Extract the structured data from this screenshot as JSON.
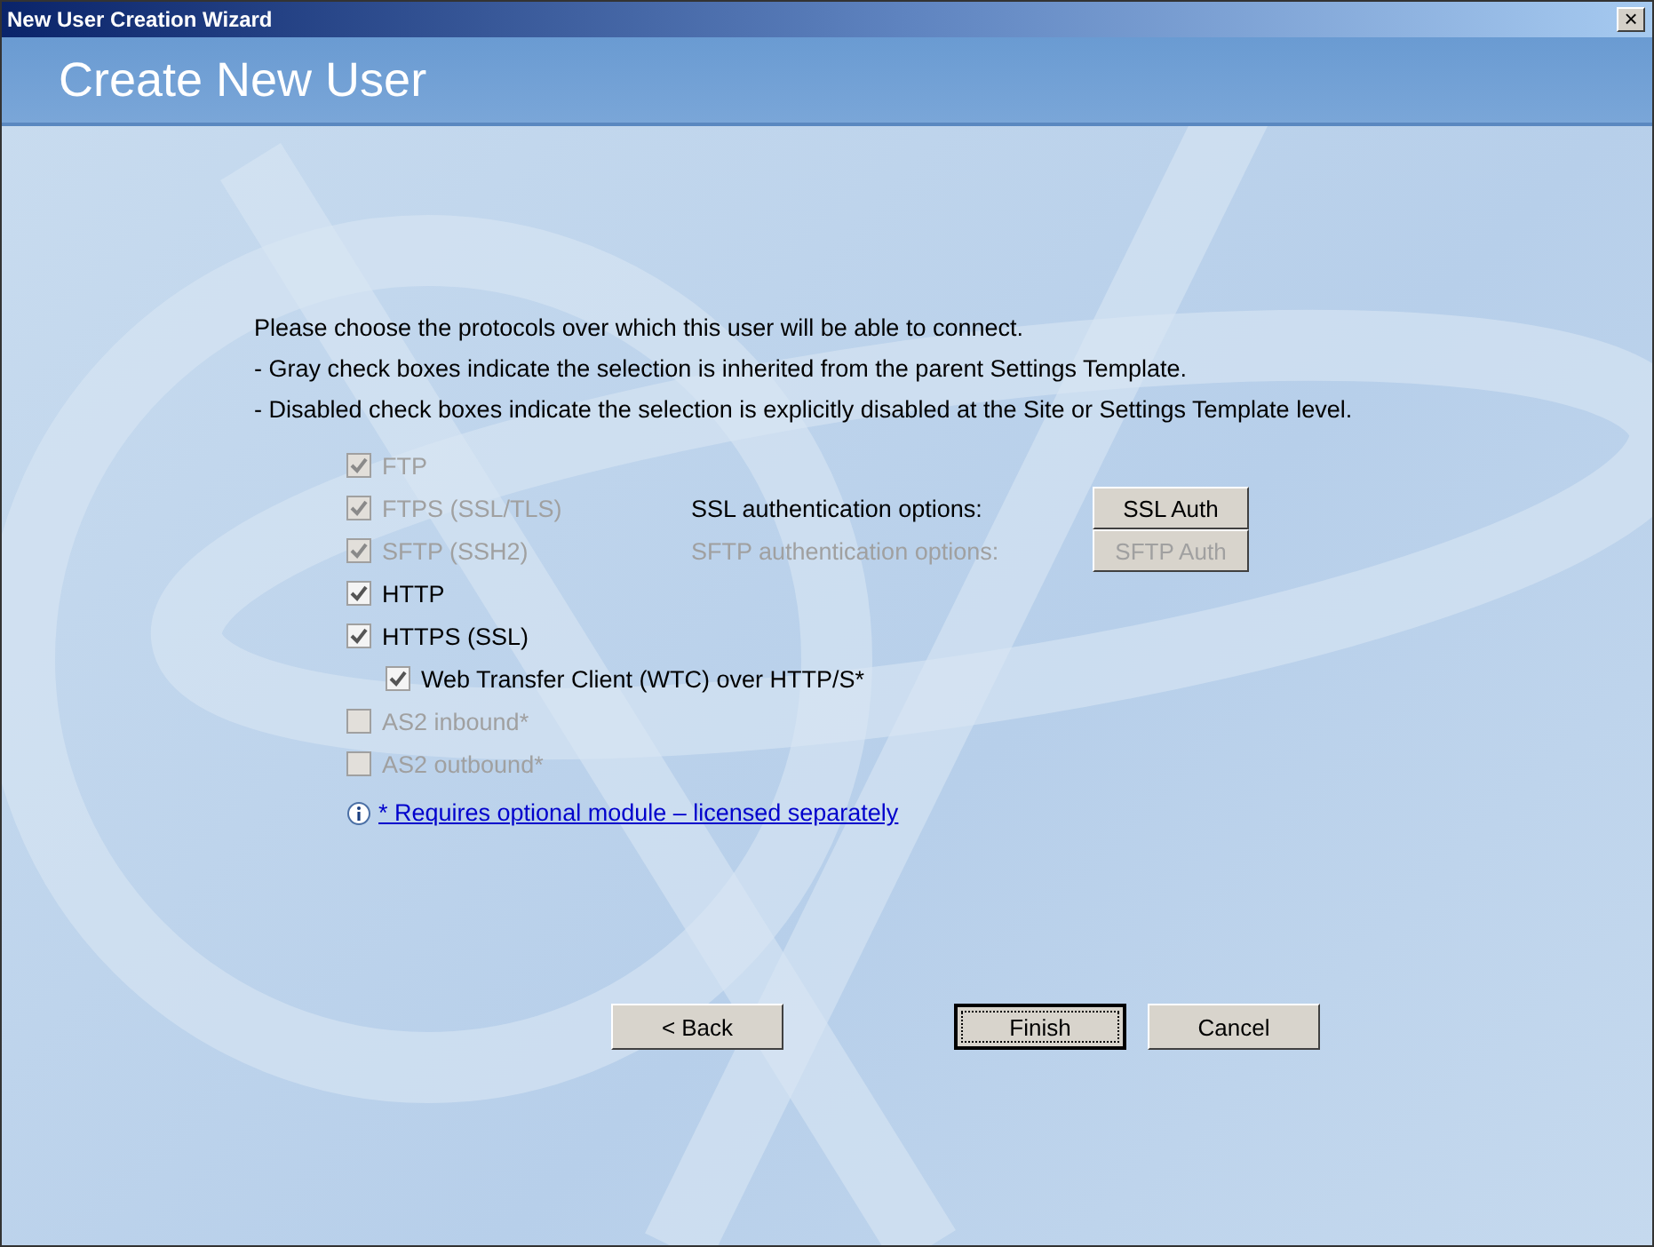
{
  "window": {
    "title": "New User Creation Wizard",
    "close": "×"
  },
  "header": {
    "title": "Create New User"
  },
  "intro": [
    "Please choose the protocols over which this user will be able to connect.",
    "- Gray check boxes indicate the selection is inherited from the parent Settings Template.",
    "- Disabled check boxes indicate the selection is explicitly disabled at the Site or Settings Template level."
  ],
  "protocols": [
    {
      "label": "FTP",
      "checked": true,
      "disabled": true
    },
    {
      "label": "FTPS (SSL/TLS)",
      "checked": true,
      "disabled": true,
      "option": {
        "label": "SSL authentication options:",
        "button": "SSL Auth",
        "disabled": false
      }
    },
    {
      "label": "SFTP (SSH2)",
      "checked": true,
      "disabled": true,
      "option": {
        "label": "SFTP authentication options:",
        "button": "SFTP Auth",
        "disabled": true
      }
    },
    {
      "label": "HTTP",
      "checked": true,
      "disabled": false
    },
    {
      "label": "HTTPS (SSL)",
      "checked": true,
      "disabled": false,
      "children": [
        {
          "label": "Web Transfer Client (WTC) over HTTP/S*",
          "checked": true,
          "disabled": false
        }
      ]
    },
    {
      "label": "AS2 inbound*",
      "checked": false,
      "disabled": true
    },
    {
      "label": "AS2 outbound*",
      "checked": false,
      "disabled": true
    }
  ],
  "note": {
    "link": "* Requires optional module – licensed separately"
  },
  "buttons": [
    {
      "label": "< Back",
      "focused": false
    },
    {
      "label": "Finish",
      "focused": true
    },
    {
      "label": "Cancel",
      "focused": false
    }
  ]
}
